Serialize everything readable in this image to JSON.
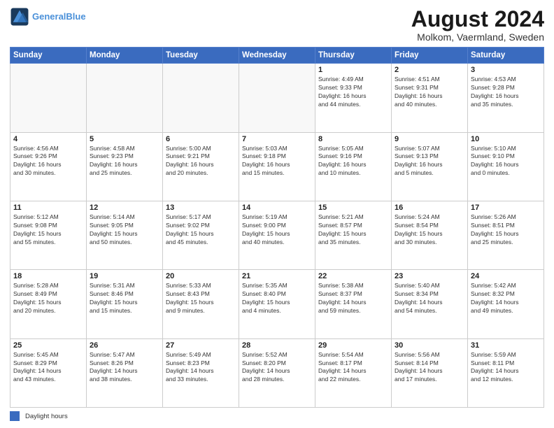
{
  "logo": {
    "line1": "General",
    "line2": "Blue"
  },
  "title": "August 2024",
  "subtitle": "Molkom, Vaermland, Sweden",
  "legend_label": "Daylight hours",
  "days_of_week": [
    "Sunday",
    "Monday",
    "Tuesday",
    "Wednesday",
    "Thursday",
    "Friday",
    "Saturday"
  ],
  "weeks": [
    [
      {
        "num": "",
        "info": ""
      },
      {
        "num": "",
        "info": ""
      },
      {
        "num": "",
        "info": ""
      },
      {
        "num": "",
        "info": ""
      },
      {
        "num": "1",
        "info": "Sunrise: 4:49 AM\nSunset: 9:33 PM\nDaylight: 16 hours\nand 44 minutes."
      },
      {
        "num": "2",
        "info": "Sunrise: 4:51 AM\nSunset: 9:31 PM\nDaylight: 16 hours\nand 40 minutes."
      },
      {
        "num": "3",
        "info": "Sunrise: 4:53 AM\nSunset: 9:28 PM\nDaylight: 16 hours\nand 35 minutes."
      }
    ],
    [
      {
        "num": "4",
        "info": "Sunrise: 4:56 AM\nSunset: 9:26 PM\nDaylight: 16 hours\nand 30 minutes."
      },
      {
        "num": "5",
        "info": "Sunrise: 4:58 AM\nSunset: 9:23 PM\nDaylight: 16 hours\nand 25 minutes."
      },
      {
        "num": "6",
        "info": "Sunrise: 5:00 AM\nSunset: 9:21 PM\nDaylight: 16 hours\nand 20 minutes."
      },
      {
        "num": "7",
        "info": "Sunrise: 5:03 AM\nSunset: 9:18 PM\nDaylight: 16 hours\nand 15 minutes."
      },
      {
        "num": "8",
        "info": "Sunrise: 5:05 AM\nSunset: 9:16 PM\nDaylight: 16 hours\nand 10 minutes."
      },
      {
        "num": "9",
        "info": "Sunrise: 5:07 AM\nSunset: 9:13 PM\nDaylight: 16 hours\nand 5 minutes."
      },
      {
        "num": "10",
        "info": "Sunrise: 5:10 AM\nSunset: 9:10 PM\nDaylight: 16 hours\nand 0 minutes."
      }
    ],
    [
      {
        "num": "11",
        "info": "Sunrise: 5:12 AM\nSunset: 9:08 PM\nDaylight: 15 hours\nand 55 minutes."
      },
      {
        "num": "12",
        "info": "Sunrise: 5:14 AM\nSunset: 9:05 PM\nDaylight: 15 hours\nand 50 minutes."
      },
      {
        "num": "13",
        "info": "Sunrise: 5:17 AM\nSunset: 9:02 PM\nDaylight: 15 hours\nand 45 minutes."
      },
      {
        "num": "14",
        "info": "Sunrise: 5:19 AM\nSunset: 9:00 PM\nDaylight: 15 hours\nand 40 minutes."
      },
      {
        "num": "15",
        "info": "Sunrise: 5:21 AM\nSunset: 8:57 PM\nDaylight: 15 hours\nand 35 minutes."
      },
      {
        "num": "16",
        "info": "Sunrise: 5:24 AM\nSunset: 8:54 PM\nDaylight: 15 hours\nand 30 minutes."
      },
      {
        "num": "17",
        "info": "Sunrise: 5:26 AM\nSunset: 8:51 PM\nDaylight: 15 hours\nand 25 minutes."
      }
    ],
    [
      {
        "num": "18",
        "info": "Sunrise: 5:28 AM\nSunset: 8:49 PM\nDaylight: 15 hours\nand 20 minutes."
      },
      {
        "num": "19",
        "info": "Sunrise: 5:31 AM\nSunset: 8:46 PM\nDaylight: 15 hours\nand 15 minutes."
      },
      {
        "num": "20",
        "info": "Sunrise: 5:33 AM\nSunset: 8:43 PM\nDaylight: 15 hours\nand 9 minutes."
      },
      {
        "num": "21",
        "info": "Sunrise: 5:35 AM\nSunset: 8:40 PM\nDaylight: 15 hours\nand 4 minutes."
      },
      {
        "num": "22",
        "info": "Sunrise: 5:38 AM\nSunset: 8:37 PM\nDaylight: 14 hours\nand 59 minutes."
      },
      {
        "num": "23",
        "info": "Sunrise: 5:40 AM\nSunset: 8:34 PM\nDaylight: 14 hours\nand 54 minutes."
      },
      {
        "num": "24",
        "info": "Sunrise: 5:42 AM\nSunset: 8:32 PM\nDaylight: 14 hours\nand 49 minutes."
      }
    ],
    [
      {
        "num": "25",
        "info": "Sunrise: 5:45 AM\nSunset: 8:29 PM\nDaylight: 14 hours\nand 43 minutes."
      },
      {
        "num": "26",
        "info": "Sunrise: 5:47 AM\nSunset: 8:26 PM\nDaylight: 14 hours\nand 38 minutes."
      },
      {
        "num": "27",
        "info": "Sunrise: 5:49 AM\nSunset: 8:23 PM\nDaylight: 14 hours\nand 33 minutes."
      },
      {
        "num": "28",
        "info": "Sunrise: 5:52 AM\nSunset: 8:20 PM\nDaylight: 14 hours\nand 28 minutes."
      },
      {
        "num": "29",
        "info": "Sunrise: 5:54 AM\nSunset: 8:17 PM\nDaylight: 14 hours\nand 22 minutes."
      },
      {
        "num": "30",
        "info": "Sunrise: 5:56 AM\nSunset: 8:14 PM\nDaylight: 14 hours\nand 17 minutes."
      },
      {
        "num": "31",
        "info": "Sunrise: 5:59 AM\nSunset: 8:11 PM\nDaylight: 14 hours\nand 12 minutes."
      }
    ]
  ]
}
